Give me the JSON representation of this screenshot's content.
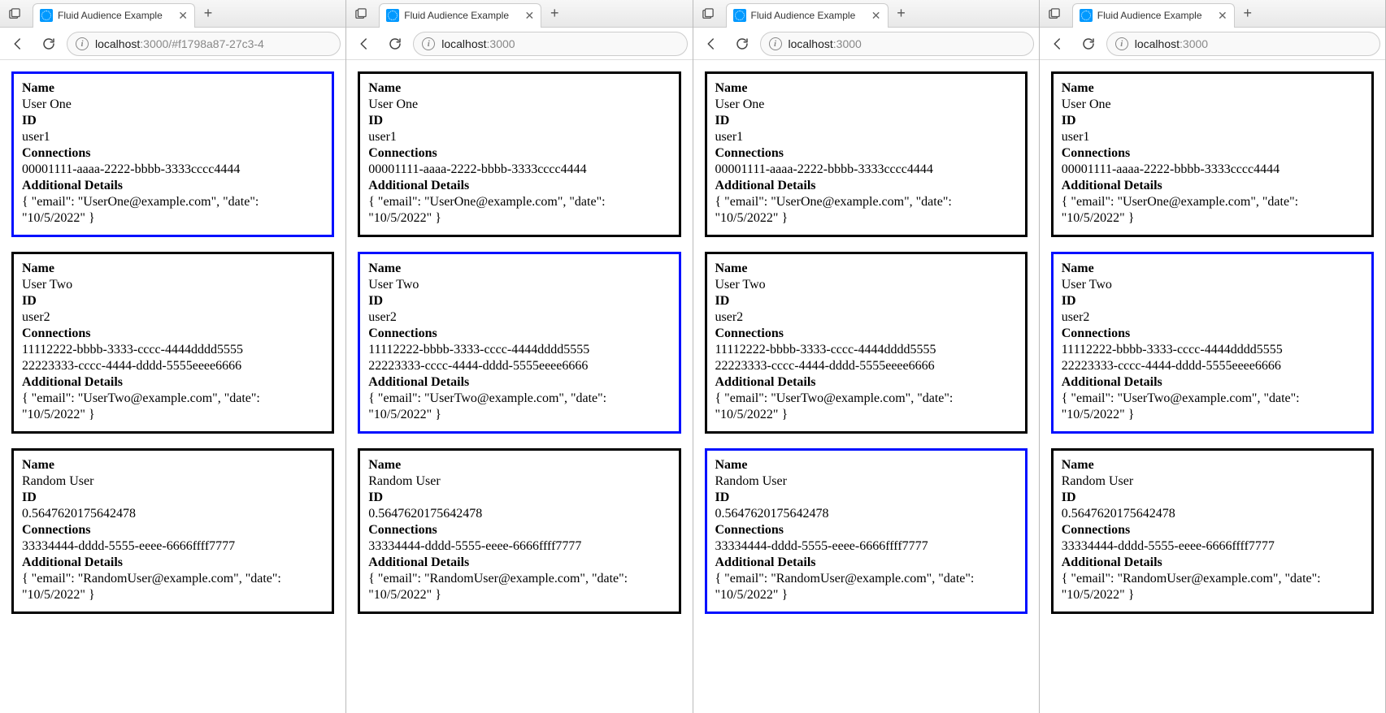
{
  "labels": {
    "name": "Name",
    "id": "ID",
    "connections": "Connections",
    "additional": "Additional Details"
  },
  "users": [
    {
      "name": "User One",
      "id": "user1",
      "connections": [
        "00001111-aaaa-2222-bbbb-3333cccc4444"
      ],
      "details": "{ \"email\": \"UserOne@example.com\", \"date\": \"10/5/2022\" }"
    },
    {
      "name": "User Two",
      "id": "user2",
      "connections": [
        "11112222-bbbb-3333-cccc-4444dddd5555",
        "22223333-cccc-4444-dddd-5555eeee6666"
      ],
      "details": "{ \"email\": \"UserTwo@example.com\", \"date\": \"10/5/2022\" }"
    },
    {
      "name": "Random User",
      "id": "0.5647620175642478",
      "connections": [
        "33334444-dddd-5555-eeee-6666ffff7777"
      ],
      "details": "{ \"email\": \"RandomUser@example.com\", \"date\": \"10/5/2022\" }"
    }
  ],
  "windows": [
    {
      "tabTitle": "Fluid Audience Example",
      "urlHost": "localhost",
      "urlRest": ":3000/#f1798a87-27c3-4",
      "highlightedIndex": 0
    },
    {
      "tabTitle": "Fluid Audience Example",
      "urlHost": "localhost",
      "urlRest": ":3000",
      "highlightedIndex": 1
    },
    {
      "tabTitle": "Fluid Audience Example",
      "urlHost": "localhost",
      "urlRest": ":3000",
      "highlightedIndex": 2
    },
    {
      "tabTitle": "Fluid Audience Example",
      "urlHost": "localhost",
      "urlRest": ":3000",
      "highlightedIndex": 1
    }
  ]
}
